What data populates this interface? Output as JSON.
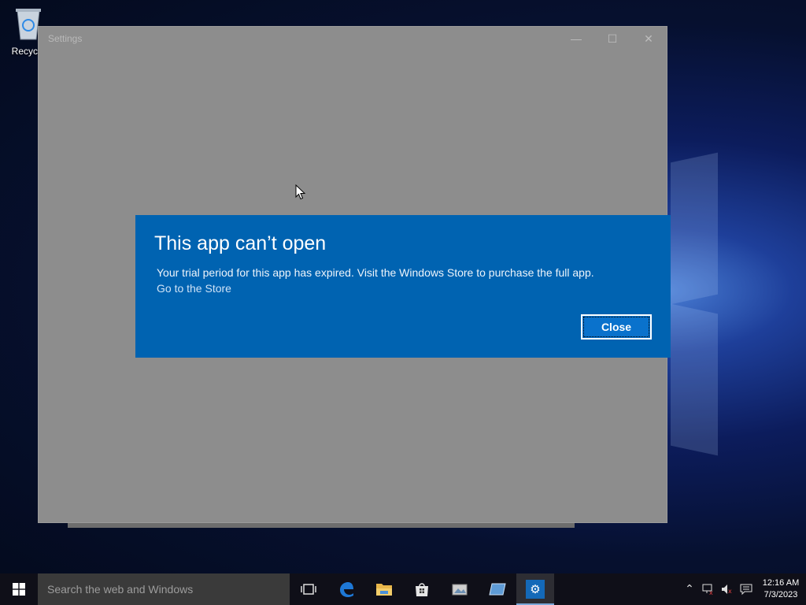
{
  "desktop": {
    "recycle_bin_label": "Recycle"
  },
  "window": {
    "title": "Settings",
    "minimize": "—",
    "maximize": "☐",
    "close": "✕"
  },
  "dialog": {
    "title": "This app can’t open",
    "message": "Your trial period for this app has expired. Visit the Windows Store to purchase the full app.",
    "link": "Go to the Store",
    "close_label": "Close",
    "accent_color": "#0063b1"
  },
  "taskbar": {
    "search_placeholder": "Search the web and Windows",
    "icons": [
      "task-view-icon",
      "edge-icon",
      "file-explorer-icon",
      "store-icon",
      "pictures-icon",
      "app-icon",
      "settings-icon"
    ],
    "time": "12:16 AM",
    "date": "7/3/2023"
  }
}
